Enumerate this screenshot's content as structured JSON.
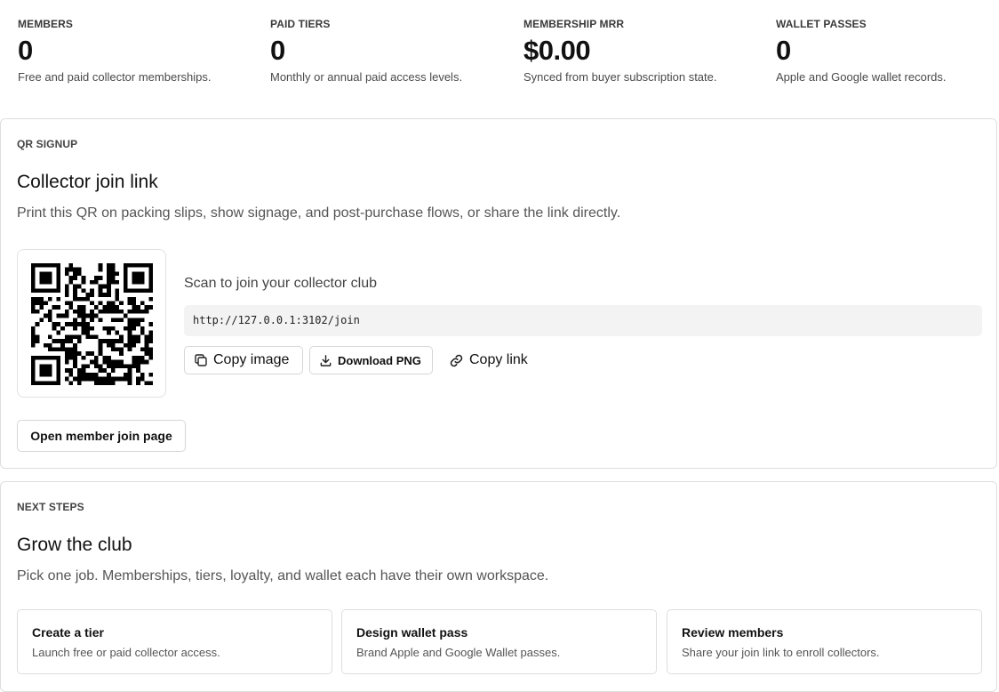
{
  "stats": [
    {
      "label": "MEMBERS",
      "value": "0",
      "desc": "Free and paid collector memberships."
    },
    {
      "label": "PAID TIERS",
      "value": "0",
      "desc": "Monthly or annual paid access levels."
    },
    {
      "label": "MEMBERSHIP MRR",
      "value": "$0.00",
      "desc": "Synced from buyer subscription state."
    },
    {
      "label": "WALLET PASSES",
      "value": "0",
      "desc": "Apple and Google wallet records."
    }
  ],
  "qr_signup": {
    "eyebrow": "QR SIGNUP",
    "title": "Collector join link",
    "description": "Print this QR on packing slips, show signage, and post-purchase flows, or share the link directly.",
    "scan_text": "Scan to join your collector club",
    "url": "http://127.0.0.1:3102/join",
    "copy_image_label": "Copy image",
    "download_label": "Download PNG",
    "copy_link_label": "Copy link",
    "open_join_label": "Open member join page",
    "icons": {
      "copy": "copy-icon",
      "download": "download-icon",
      "link": "link-icon",
      "qr": "qr-code"
    }
  },
  "next_steps": {
    "eyebrow": "NEXT STEPS",
    "title": "Grow the club",
    "description": "Pick one job. Memberships, tiers, loyalty, and wallet each have their own workspace.",
    "tiles": [
      {
        "title": "Create a tier",
        "desc": "Launch free or paid collector access."
      },
      {
        "title": "Design wallet pass",
        "desc": "Brand Apple and Google Wallet passes."
      },
      {
        "title": "Review members",
        "desc": "Share your join link to enroll collectors."
      }
    ]
  }
}
